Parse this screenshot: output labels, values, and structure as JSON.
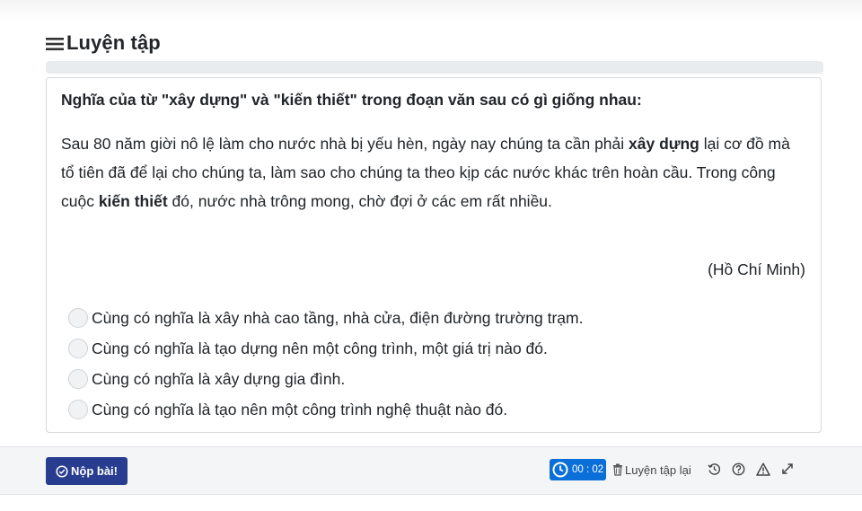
{
  "header": {
    "title": "Luyện tập",
    "menu_icon": "hamburger-menu-icon"
  },
  "progress": {
    "fraction": 0.0
  },
  "question": {
    "title": "Nghĩa của từ \"xây dựng\" và \"kiến thiết\" trong đoạn văn sau có gì giống nhau:",
    "passage": {
      "p1": "Sau 80 năm giời nô lệ làm cho nước nhà bị yếu hèn, ngày nay chúng ta cần phải ",
      "b1": "xây dựng",
      "p2": " lại cơ đồ mà tổ tiên đã để lại cho chúng ta, làm sao cho chúng ta theo kịp các nước khác trên hoàn cầu. Trong công cuộc ",
      "b2": "kiến thiết",
      "p3": " đó, nước nhà trông mong, chờ đợi ở các em rất nhiều."
    },
    "author": "(Hồ Chí Minh)",
    "options": [
      "Cùng có nghĩa là xây nhà cao tầng, nhà cửa, điện đường trường trạm.",
      "Cùng có nghĩa là tạo dựng nên một công trình, một giá trị nào đó.",
      "Cùng có nghĩa là xây dựng gia đình.",
      "Cùng có nghĩa là tạo nên một công trình nghệ thuật nào đó."
    ]
  },
  "footer": {
    "submit_label": "Nộp bài!",
    "timer": "00 : 02",
    "retry_label": "Luyện tập lại",
    "icons": [
      "check-circle-icon",
      "clock-icon",
      "trash-icon",
      "history-icon",
      "help-icon",
      "warning-icon",
      "fullscreen-icon"
    ]
  },
  "colors": {
    "submit_bg": "#283d8f",
    "timer_bg": "#0a6fd8",
    "progress_track": "#e9ecef",
    "footer_bg": "#f4f5f6"
  }
}
